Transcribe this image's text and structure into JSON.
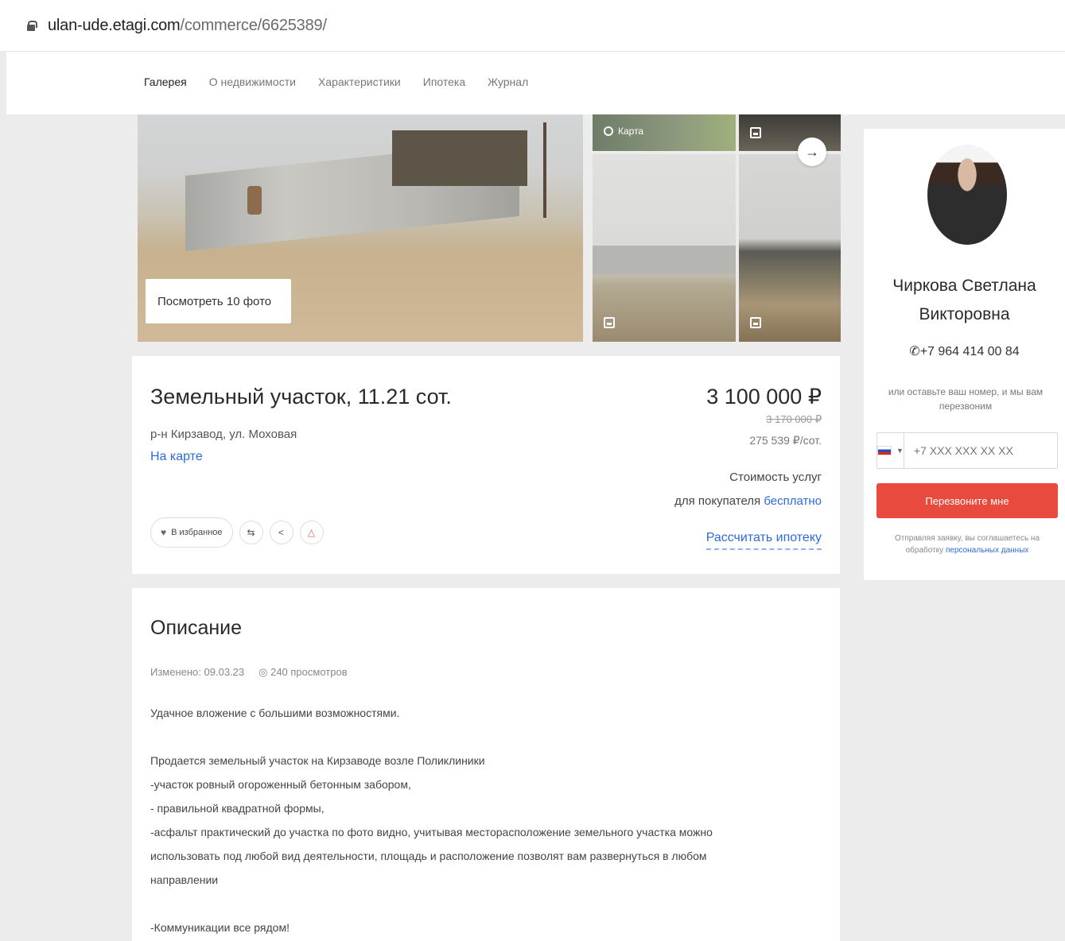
{
  "browser": {
    "url_host": "ulan-ude.etagi.com",
    "url_path": "/commerce/6625389/"
  },
  "nav": {
    "tabs": [
      "Галерея",
      "О недвижимости",
      "Характеристики",
      "Ипотека",
      "Журнал"
    ],
    "active": "Галерея"
  },
  "gallery": {
    "view_photos": "Посмотреть 10 фото",
    "map_label": "Карта"
  },
  "listing": {
    "title": "Земельный участок, 11.21 сот.",
    "address": "р-н Кирзавод, ул. Моховая",
    "map_link": "На карте",
    "price": "3 100 000 ₽",
    "old_price": "3 170 000 ₽",
    "price_per_sotka": "275 539 ₽/сот.",
    "services_line1": "Стоимость услуг",
    "services_line2": "для покупателя",
    "services_free": "бесплатно",
    "mortgage_link": "Рассчитать ипотеку",
    "favorite_label": "В избранное"
  },
  "description": {
    "heading": "Описание",
    "changed": "Изменено: 09.03.23",
    "views": "240 просмотров",
    "paragraphs": [
      "Удачное вложение с большими возможностями.",
      "",
      "Продается земельный участок на Кирзаводе возле Поликлиники",
      "-участок ровный огороженный бетонным забором,",
      "- правильной квадратной формы,",
      "-асфальт практический до участка по фото видно, учитывая месторасположение земельного участка можно",
      "использовать под любой вид деятельности, площадь и расположение позволят вам развернуться в любом",
      "направлении",
      "",
      "-Коммуникации все рядом!"
    ]
  },
  "agent": {
    "name_line1": "Чиркова Светлана",
    "name_line2": "Викторовна",
    "phone": "+7 964 414 00 84",
    "hint": "или оставьте ваш номер, и мы вам перезвоним",
    "phone_placeholder": "+7 XXX XXX XX XX",
    "call_button": "Перезвоните мне",
    "consent_text": "Отправляя заявку, вы соглашаетесь на обработку",
    "consent_link": "персональных данных"
  },
  "colors": {
    "accent_red": "#e84a3d",
    "link_blue": "#2f6bd8",
    "page_bg": "#ececec"
  }
}
